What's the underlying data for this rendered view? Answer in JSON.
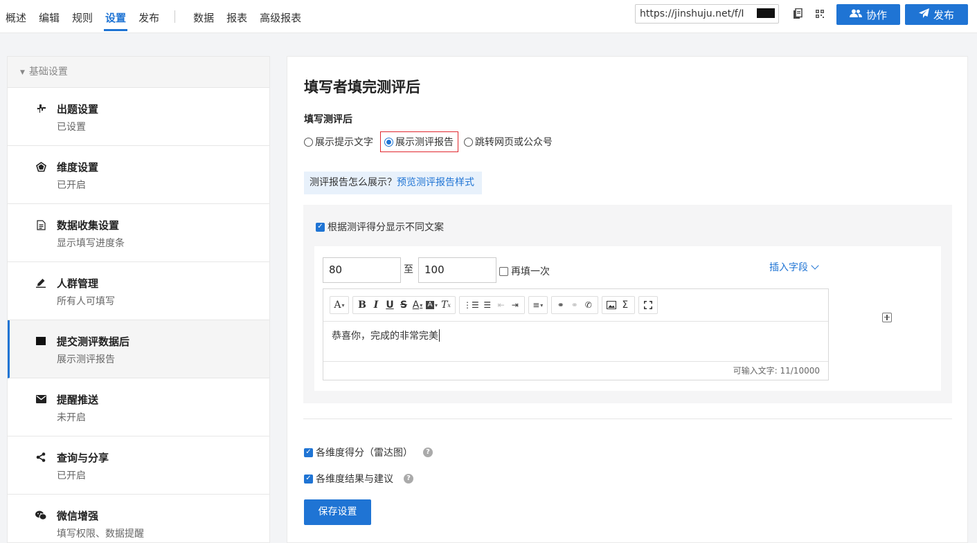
{
  "topnav": {
    "items": [
      "概述",
      "编辑",
      "规则",
      "设置",
      "发布"
    ],
    "items2": [
      "数据",
      "报表",
      "高级报表"
    ],
    "active": "设置"
  },
  "header": {
    "url": "https://jinshuju.net/f/I",
    "collab_label": "协作",
    "publish_label": "发布",
    "accent": "#1f74d4"
  },
  "sidebar": {
    "section": "基础设置",
    "items": [
      {
        "title": "出题设置",
        "sub": "已设置",
        "icon": "puzzle-icon"
      },
      {
        "title": "维度设置",
        "sub": "已开启",
        "icon": "radar-icon"
      },
      {
        "title": "数据收集设置",
        "sub": "显示填写进度条",
        "icon": "document-icon"
      },
      {
        "title": "人群管理",
        "sub": "所有人可填写",
        "icon": "pen-icon"
      },
      {
        "title": "提交测评数据后",
        "sub": "展示测评报告",
        "icon": "square-icon"
      },
      {
        "title": "提醒推送",
        "sub": "未开启",
        "icon": "envelope-icon"
      },
      {
        "title": "查询与分享",
        "sub": "已开启",
        "icon": "share-icon"
      },
      {
        "title": "微信增强",
        "sub": "填写权限、数据提醒",
        "icon": "wechat-icon"
      }
    ]
  },
  "main": {
    "title": "填写者填完测评后",
    "section_label": "填写测评后",
    "radios": [
      "展示提示文字",
      "展示测评报告",
      "跳转网页或公众号"
    ],
    "radio_selected": "展示测评报告",
    "hint_text": "测评报告怎么展示？",
    "hint_link": "预览测评报告样式",
    "score_copy_label": "根据测评得分显示不同文案",
    "range_from": "80",
    "range_to_label": "至",
    "range_to": "100",
    "refill_label": "再填一次",
    "insert_field_label": "插入字段",
    "editor_content": "恭喜你，完成的非常完美",
    "char_count": "可输入文字: 11/10000",
    "radar_label": "各维度得分（雷达图）",
    "advice_label": "各维度结果与建议",
    "save_label": "保存设置"
  }
}
